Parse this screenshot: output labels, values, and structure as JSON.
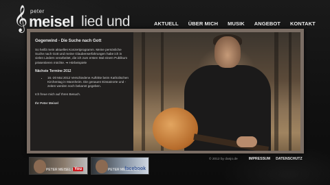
{
  "logo": {
    "clef_glyph": "𝄞",
    "small": "peter",
    "name": "meisel",
    "subtitle": "lied und ton"
  },
  "nav": {
    "items": [
      "AKTUELL",
      "ÜBER MICH",
      "MUSIK",
      "ANGEBOT",
      "KONTAKT"
    ]
  },
  "article": {
    "title": "Gegenwind - Die Suche nach Gott",
    "intro": "So heißt mein aktuelles Konzertprogramm. Meine persönliche Suche nach Gott und meine Glaubenserfahrungen habe ich in vielen Liedern verarbeitet, die ich zum ersten Mal einem Publikum präsentieren möchte. ➔ Hörbeispiele",
    "dates_heading": "Nächste Termine 2012",
    "dates": [
      "16.-20 Mai 2012 Verschiedene Auftritte beim Katholischen Kirchentag in Mannheim. Die genauen Einsatzorte und -zeiten werden noch bekannt gegeben."
    ],
    "outro": "Ich freue mich auf Ihren Besuch.",
    "signature": "Ihr Peter Meisel"
  },
  "thumbs": [
    {
      "caption": "PETER MEISEL ON",
      "brand": "You"
    },
    {
      "caption": "PETER MEISEL ON",
      "brand": "facebook"
    }
  ],
  "footer": {
    "copyright": "© 2012 by danjo.de",
    "links": [
      "IMPRESSUM",
      "DATENSCHUTZ"
    ]
  }
}
